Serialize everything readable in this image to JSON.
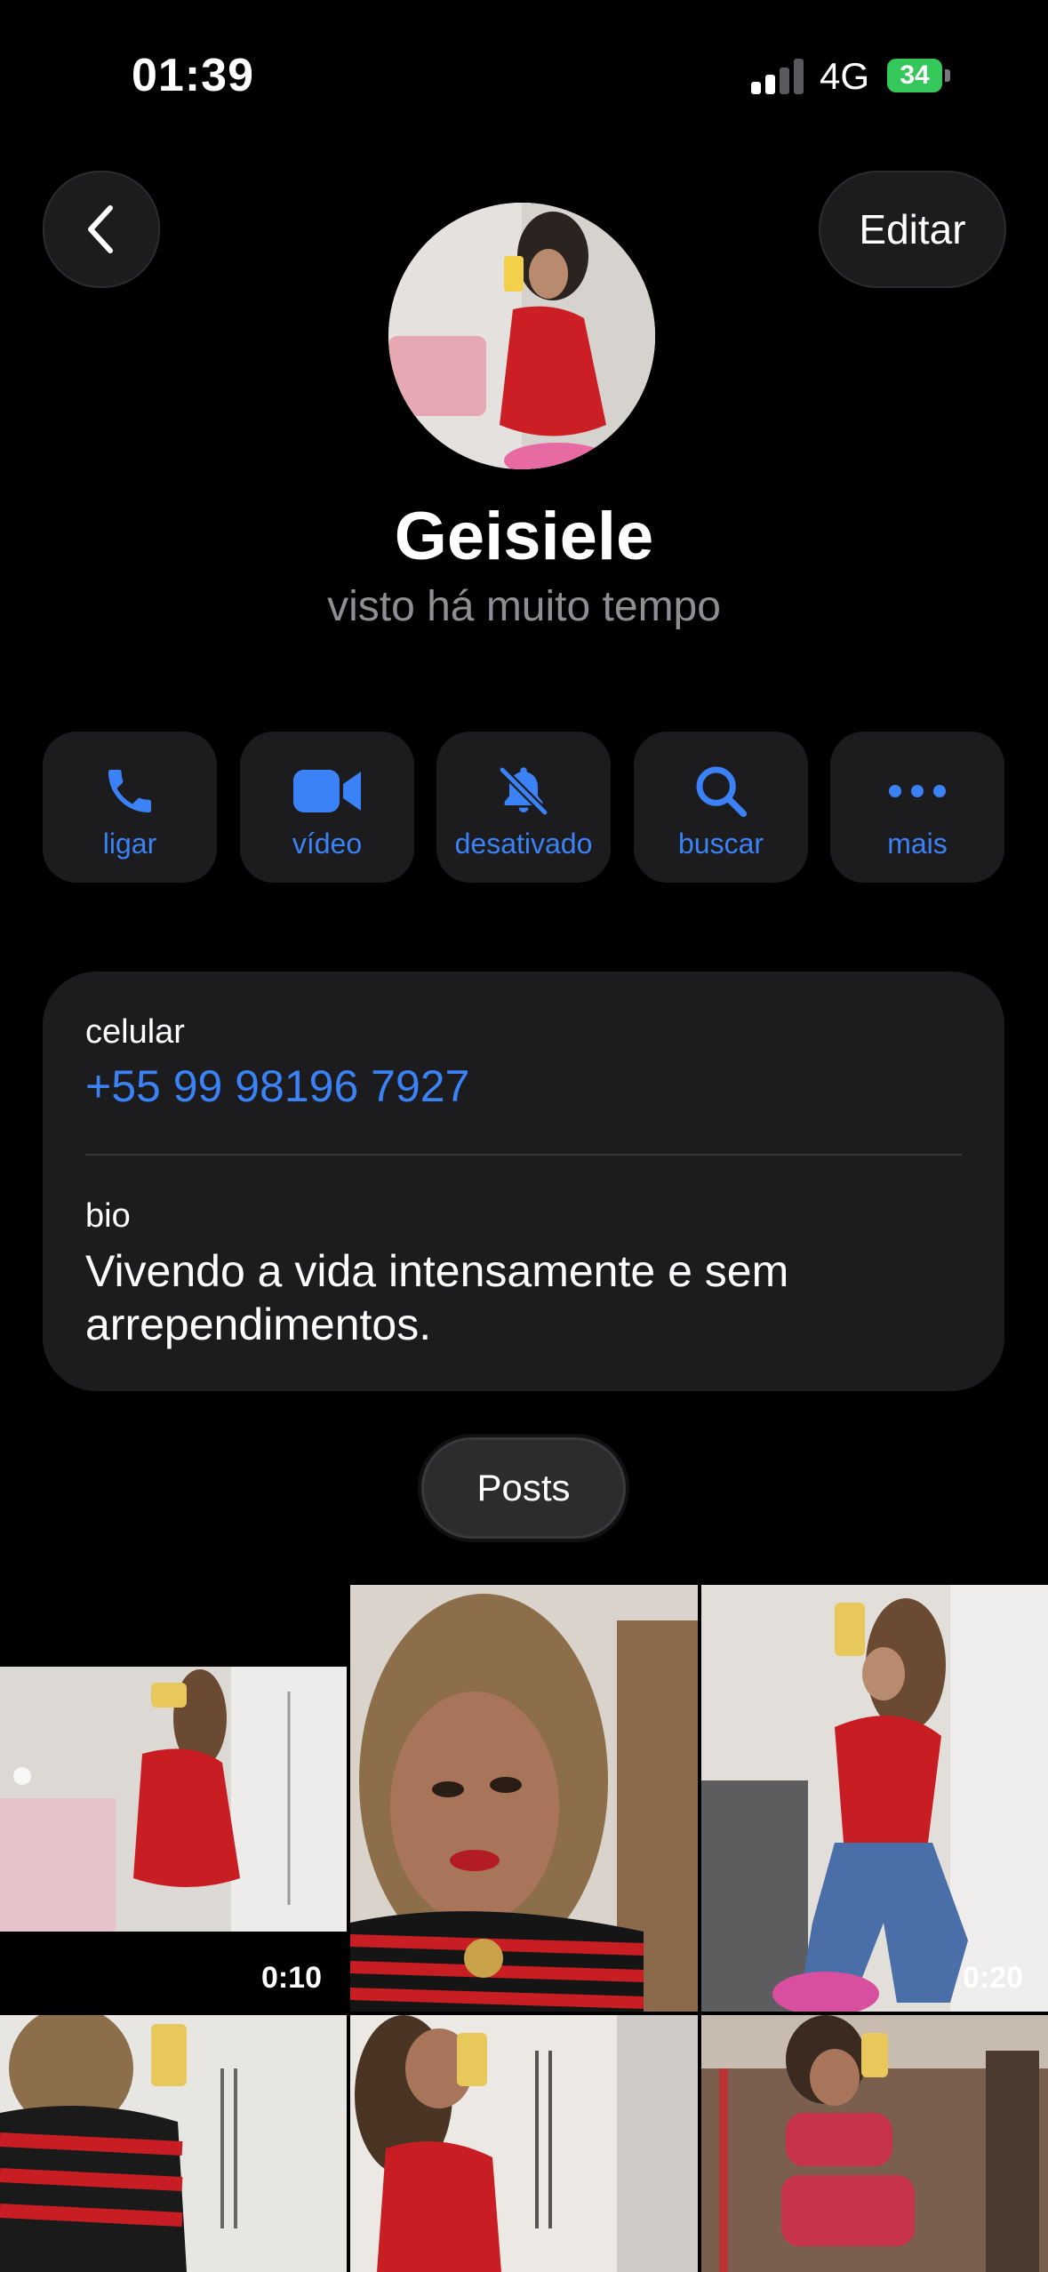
{
  "status_bar": {
    "time": "01:39",
    "network": "4G",
    "battery": "34"
  },
  "header": {
    "edit_label": "Editar"
  },
  "profile": {
    "name": "Geisiele",
    "last_seen": "visto há muito tempo"
  },
  "actions": [
    {
      "label": "ligar",
      "icon": "phone-icon"
    },
    {
      "label": "vídeo",
      "icon": "video-icon"
    },
    {
      "label": "desativado",
      "icon": "bell-slash-icon"
    },
    {
      "label": "buscar",
      "icon": "search-icon"
    },
    {
      "label": "mais",
      "icon": "more-icon"
    }
  ],
  "info": {
    "phone_label": "celular",
    "phone": "+55 99 98196 7927",
    "bio_label": "bio",
    "bio": "Vivendo a vida intensamente e sem arrependimentos."
  },
  "tabs": {
    "posts": "Posts"
  },
  "media": [
    {
      "kind": "video",
      "duration": "0:10"
    },
    {
      "kind": "photo",
      "duration": ""
    },
    {
      "kind": "video",
      "duration": "0:20"
    },
    {
      "kind": "photo",
      "duration": ""
    },
    {
      "kind": "photo",
      "duration": ""
    },
    {
      "kind": "photo",
      "duration": ""
    }
  ],
  "colors": {
    "accent": "#3b82f6",
    "background": "#000000",
    "card": "#1c1c1e",
    "battery": "#34c759"
  }
}
